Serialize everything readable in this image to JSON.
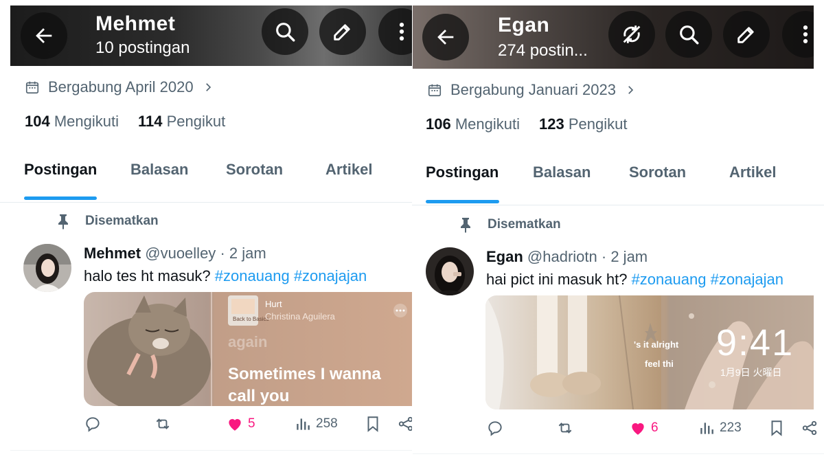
{
  "left": {
    "header": {
      "name": "Mehmet",
      "posts": "10 postingan"
    },
    "joined": "Bergabung April 2020",
    "following_count": "104",
    "following_label": "Mengikuti",
    "followers_count": "114",
    "followers_label": "Pengikut",
    "tabs": [
      "Postingan",
      "Balasan",
      "Sorotan",
      "Artikel"
    ],
    "pinned_label": "Disematkan",
    "tweet": {
      "name": "Mehmet",
      "handle": "@vuoelley",
      "time": "· 2 jam",
      "text": "halo tes ht masuk?",
      "tag1": "#zonauang",
      "tag2": "#zonajajan"
    },
    "media": {
      "song_title": "Hurt",
      "artist": "Christina Aguilera",
      "faint_lyric": "again",
      "lyric_line1": "Sometimes I wanna",
      "lyric_line2": "call you"
    },
    "actions": {
      "likes": "5",
      "views": "258"
    }
  },
  "right": {
    "header": {
      "name": "Egan",
      "posts": "274 postin..."
    },
    "joined": "Bergabung Januari 2023",
    "following_count": "106",
    "following_label": "Mengikuti",
    "followers_count": "123",
    "followers_label": "Pengikut",
    "tabs": [
      "Postingan",
      "Balasan",
      "Sorotan",
      "Artikel"
    ],
    "pinned_label": "Disematkan",
    "tweet": {
      "name": "Egan",
      "handle": "@hadriotn",
      "time": "· 2 jam",
      "text": "hai pict ini masuk ht?",
      "tag1": "#zonauang",
      "tag2": "#zonajajan"
    },
    "media": {
      "overlay1": "'s it alright",
      "overlay2": "feel thi",
      "clock": "9:41",
      "date": "1月9日 火曜日"
    },
    "actions": {
      "likes": "6",
      "views": "223"
    }
  },
  "colors": {
    "accent": "#1d9bf0",
    "like": "#f91880",
    "muted": "#536471"
  },
  "icons": [
    "back-arrow-icon",
    "search-icon",
    "edit-icon",
    "more-icon",
    "no-sync-icon",
    "calendar-icon",
    "chevron-right-icon",
    "pin-icon",
    "reply-icon",
    "retweet-icon",
    "heart-icon",
    "views-icon",
    "bookmark-icon",
    "share-icon"
  ]
}
